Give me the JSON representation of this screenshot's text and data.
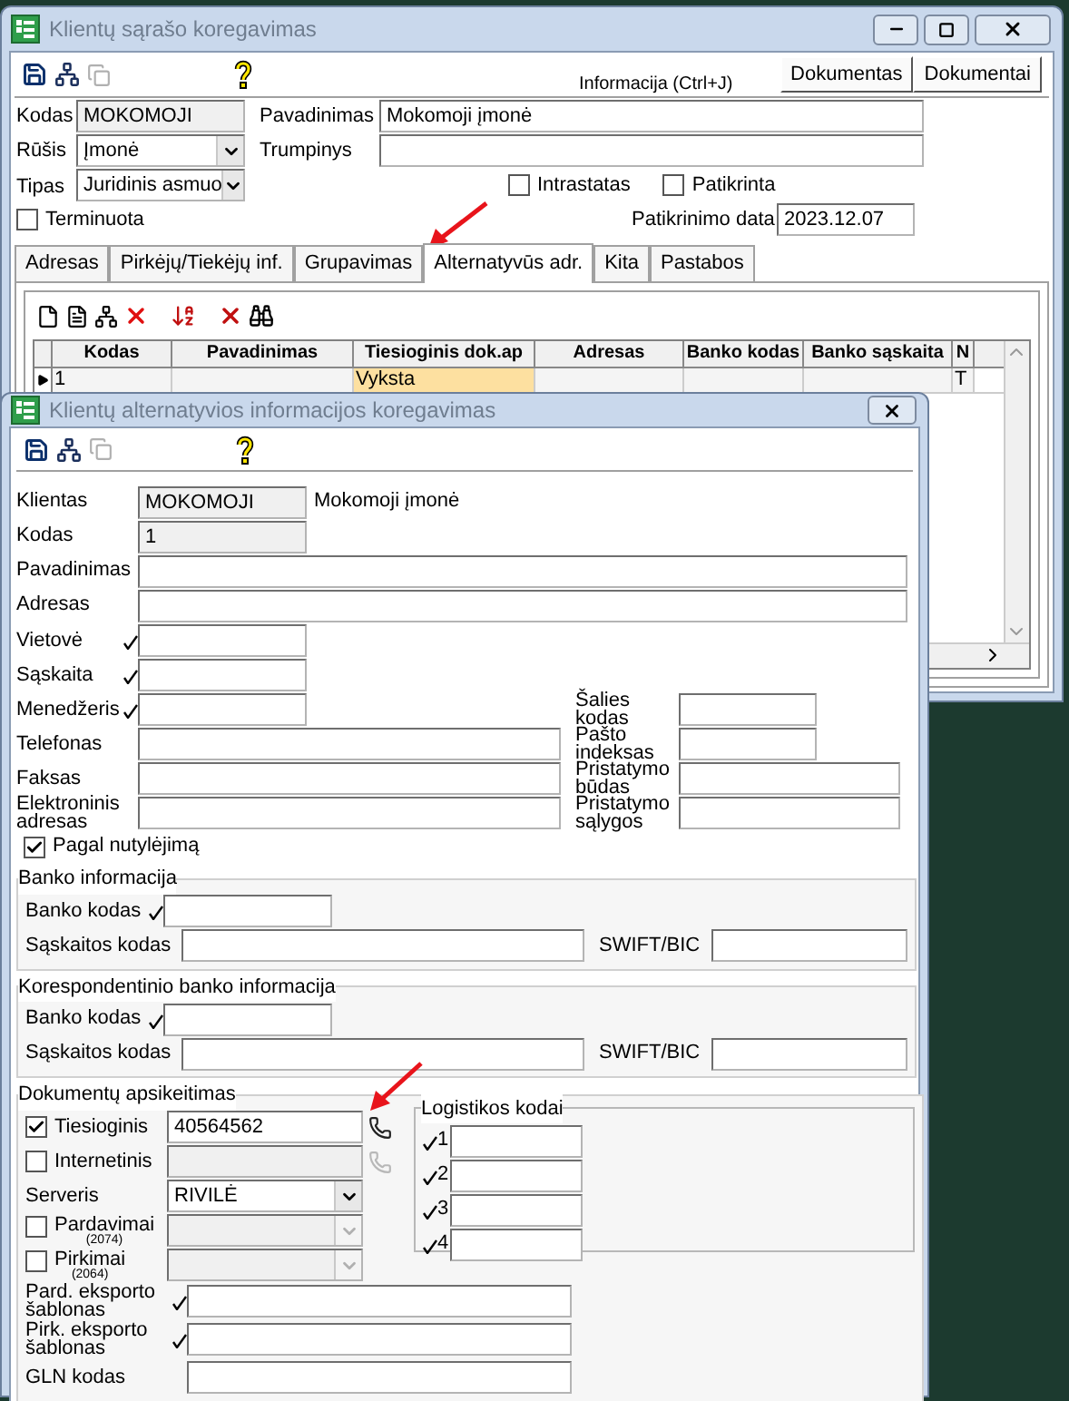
{
  "main_window": {
    "title": "Klientų sąrašo koregavimas",
    "info_hint": "Informacija (Ctrl+J)",
    "buttons": [
      "Dokumentas",
      "Dokumentai"
    ],
    "code": {
      "label": "Kodas",
      "value": "MOKOMOJI"
    },
    "name": {
      "label": "Pavadinimas",
      "value": "Mokomoji įmonė"
    },
    "category": {
      "label": "Rūšis",
      "value": "Įmonė"
    },
    "short_name": {
      "label": "Trumpinys"
    },
    "type": {
      "label": "Tipas",
      "value": "Juridinis asmuo"
    },
    "flags": [
      {
        "label": "Intrastatas",
        "checked": false
      },
      {
        "label": "Patikrinta",
        "checked": false
      }
    ],
    "terminated": {
      "label": "Terminuota",
      "checked": false
    },
    "check_date": {
      "label": "Patikrinimo data",
      "value": "2023.12.07"
    },
    "tabs": [
      {
        "label": "Adresas",
        "selected": false
      },
      {
        "label": "Pirkėjų/Tiekėjų inf.",
        "selected": false
      },
      {
        "label": "Grupavimas",
        "selected": false
      },
      {
        "label": "Alternatyvūs adr.",
        "selected": true
      },
      {
        "label": "Kita",
        "selected": false
      },
      {
        "label": "Pastabos",
        "selected": false
      }
    ],
    "grid": {
      "columns": [
        "Kodas",
        "Pavadinimas",
        "Tiesioginis dok.ap",
        "Adresas",
        "Banko kodas",
        "Banko sąskaita",
        "N"
      ],
      "rows": [
        {
          "current": true,
          "cells": [
            {
              "text": "1",
              "selected": false
            },
            {
              "selected": false
            },
            {
              "text": "Vyksta",
              "selected": true
            },
            {
              "selected": false
            },
            {
              "selected": false
            },
            {
              "selected": false
            },
            {
              "text": "T",
              "selected": false
            }
          ]
        }
      ]
    }
  },
  "alt_window": {
    "title": "Klientų alternatyvios informacijos koregavimas",
    "client": {
      "label": "Klientas",
      "code": "MOKOMOJI",
      "name": "Mokomoji įmonė"
    },
    "code": {
      "label": "Kodas",
      "value": "1"
    },
    "wide_fields": [
      {
        "label": "Pavadinimas"
      },
      {
        "label": "Adresas"
      }
    ],
    "left_fields": [
      {
        "label": "Vietovė",
        "lookup": true
      },
      {
        "label": "Sąskaita",
        "lookup": true
      },
      {
        "label": "Menedžeris",
        "lookup": true
      },
      {
        "label": "Telefonas",
        "lookup": false
      },
      {
        "label": "Faksas",
        "lookup": false
      },
      {
        "label": "Elektroninis adresas",
        "lookup": false
      }
    ],
    "right_fields": [
      {
        "label": "Šalies kodas"
      },
      {
        "label": "Pašto indeksas"
      },
      {
        "label": "Pristatymo būdas"
      },
      {
        "label": "Pristatymo sąlygos"
      }
    ],
    "default": {
      "label": "Pagal nutylėjimą",
      "checked": true
    },
    "bank_groups": [
      {
        "title": "Banko informacija",
        "bank_code": {
          "label": "Banko kodas",
          "lookup": true
        },
        "account": {
          "label": "Sąskaitos kodas"
        },
        "swift": {
          "label": "SWIFT/BIC"
        }
      },
      {
        "title": "Korespondentinio banko informacija",
        "bank_code": {
          "label": "Banko kodas",
          "lookup": true
        },
        "account": {
          "label": "Sąskaitos kodas"
        },
        "swift": {
          "label": "SWIFT/BIC"
        }
      }
    ],
    "documents": {
      "title": "Dokumentų apsikeitimas",
      "rows": [
        {
          "kind": "check_field",
          "label": "Tiesioginis",
          "checked": true,
          "value": "40564562",
          "disabled": false
        },
        {
          "kind": "check_field",
          "label": "Internetinis",
          "checked": false,
          "disabled": true
        },
        {
          "kind": "select",
          "label": "Serveris",
          "value": "RIVILĖ",
          "disabled": false
        },
        {
          "kind": "check_select",
          "label": "Pardavimai",
          "sub": "(2074)",
          "checked": false,
          "disabled": true
        },
        {
          "kind": "check_select",
          "label": "Pirkimai",
          "sub": "(2064)",
          "checked": false,
          "disabled": true
        },
        {
          "kind": "field",
          "label": "Pard. eksporto šablonas",
          "lookup": true,
          "disabled": false
        },
        {
          "kind": "field",
          "label": "Pirk. eksporto šablonas",
          "lookup": true,
          "disabled": false
        },
        {
          "kind": "field",
          "label": "GLN kodas",
          "lookup": false,
          "disabled": false
        }
      ]
    },
    "logistics": {
      "title": "Logistikos kodai",
      "fields": [
        {
          "label": "1",
          "lookup": true
        },
        {
          "label": "2",
          "lookup": true
        },
        {
          "label": "3",
          "lookup": true
        },
        {
          "label": "4",
          "lookup": true
        }
      ]
    }
  }
}
